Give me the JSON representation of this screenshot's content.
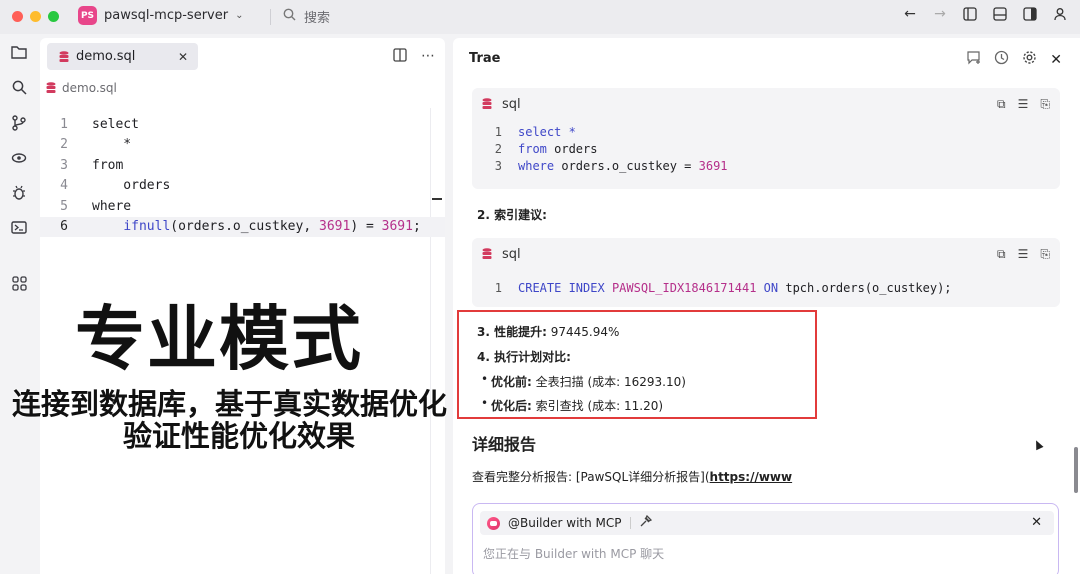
{
  "window": {
    "project_badge": "PS",
    "project_name": "pawsql-mcp-server",
    "search_placeholder": "搜索"
  },
  "editor": {
    "tab_label": "demo.sql",
    "breadcrumb": "demo.sql",
    "lines": [
      {
        "n": "1",
        "text": "select"
      },
      {
        "n": "2",
        "text": "    *"
      },
      {
        "n": "3",
        "text": "from"
      },
      {
        "n": "4",
        "text": "    orders"
      },
      {
        "n": "5",
        "text": "where"
      },
      {
        "n": "6",
        "text": "    ifnull(orders.o_custkey, 3691) = 3691;"
      }
    ]
  },
  "overlay": {
    "headline": "专业模式",
    "line1": "连接到数据库，基于真实数据优化",
    "line2": "验证性能优化效果"
  },
  "panel": {
    "title": "Trae",
    "block1": {
      "lang": "sql",
      "lines": [
        {
          "n": "1",
          "text": "select *"
        },
        {
          "n": "2",
          "text": "from orders"
        },
        {
          "n": "3",
          "text": "where orders.o_custkey = 3691"
        }
      ]
    },
    "item2_label": "2. 索引建议:",
    "block2": {
      "lang": "sql",
      "lines": [
        {
          "n": "1",
          "text": "CREATE INDEX PAWSQL_IDX1846171441 ON tpch.orders(o_custkey);"
        }
      ]
    },
    "item3_label": "3. 性能提升:",
    "item3_value": " 97445.94%",
    "item4_label": "4. 执行计划对比:",
    "before_label": "优化前:",
    "before_value": " 全表扫描 (成本: 16293.10)",
    "after_label": "优化后:",
    "after_value": " 索引查找 (成本: 11.20)",
    "detail_title": "详细报告",
    "detail_text": "查看完整分析报告: [PawSQL详细分析报告](",
    "detail_link": "https://www",
    "chat": {
      "agent": "@Builder with MCP",
      "placeholder": "您正在与 Builder with MCP 聊天"
    }
  },
  "colors": {
    "accent_badge": "#e8468a",
    "highlight_box": "#e23b3b",
    "keyword": "#3f47c8",
    "number": "#b52f8a"
  }
}
